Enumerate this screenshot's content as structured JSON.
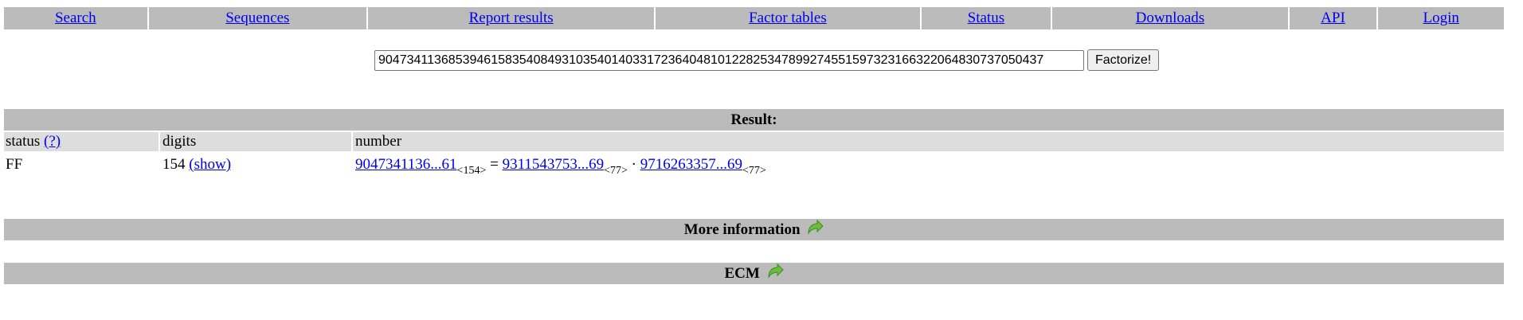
{
  "nav": {
    "items": [
      {
        "label": "Search",
        "width": 180
      },
      {
        "label": "Sequences",
        "width": 274
      },
      {
        "label": "Report results",
        "width": 360
      },
      {
        "label": "Factor tables",
        "width": 332
      },
      {
        "label": "Status",
        "width": 163
      },
      {
        "label": "Downloads",
        "width": 296
      },
      {
        "label": "API",
        "width": 110
      },
      {
        "label": "Login",
        "width": 158
      }
    ]
  },
  "search": {
    "value": "9047341136853946158354084931035401403317236404810122825347899274551597323166322064830737050437",
    "button_label": "Factorize!"
  },
  "result": {
    "title": "Result:",
    "headers": {
      "status": "status",
      "status_help": "(?)",
      "digits": "digits",
      "number": "number"
    },
    "row": {
      "status": "FF",
      "digits": "154",
      "show_link": "(show)",
      "number_link": "9047341136...61",
      "number_digits": "<154>",
      "equals": " = ",
      "factor1_link": "9311543753...69",
      "factor1_digits": "<77>",
      "times": " · ",
      "factor2_link": "9716263357...69",
      "factor2_digits": "<77>"
    }
  },
  "sections": {
    "more_info": "More information",
    "ecm": "ECM"
  },
  "colors": {
    "bar": "#bbbbbb",
    "header_row": "#dddddd",
    "link": "#0000ee",
    "arrow": "#6abf3a"
  }
}
